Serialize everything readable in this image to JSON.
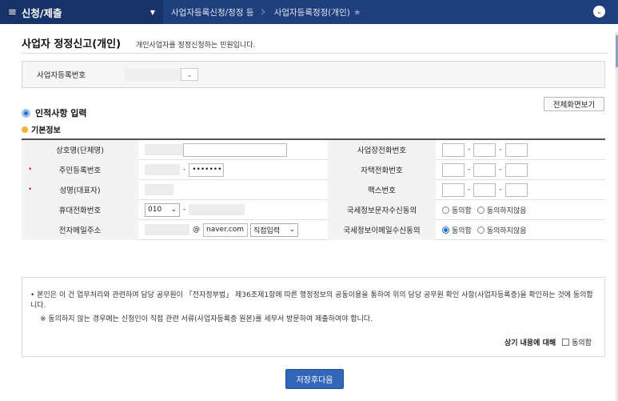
{
  "nav": {
    "menu_title": "신청/제출",
    "crumbs": [
      "사업자등록신청/정정 등",
      "사업자등록정정(개인)"
    ]
  },
  "page": {
    "title": "사업자 정정신고(개인)",
    "desc": "개인사업자를 정정신청하는 민원입니다."
  },
  "bizno": {
    "label": "사업자등록번호"
  },
  "sections": {
    "personal": "인적사항 입력",
    "basic": "기본정보",
    "fullview_btn": "전체화면보기"
  },
  "form": {
    "trade_name": "상호명(단체명)",
    "resident_no": "주민등록번호",
    "resident_masked": "•••••••",
    "name": "성명(대표자)",
    "mobile": "휴대전화번호",
    "mobile_prefix": "010",
    "email": "전자메일주소",
    "email_domain": "naver.com",
    "email_select": "직접입력",
    "biz_phone": "사업장전화번호",
    "home_phone": "자택전화번호",
    "fax": "팩스번호",
    "sms_consent": "국세정보문자수신동의",
    "email_consent": "국세정보이메일수신동의",
    "agree": "동의함",
    "disagree": "동의하지않음",
    "at": "@",
    "dash": "-"
  },
  "consent": {
    "text1": "• 본인은 이 건 업무처리와 관련하여 담당 공무원이 「전자정부법」 제36조제1항에 따른 행정정보의 공동이용을 통하여 위의 담당 공무원 확인 사항(사업자등록증)을 확인하는 것에 동의합니다.",
    "text2": "※  동의하지 않는 경우에는 신청인이 직접 관련 서류(사업자등록증 원본)를 세무서 방문하여 제출하여야 합니다.",
    "agree_label": "상기 내용에 대해",
    "agree_check": "동의함"
  },
  "buttons": {
    "save_next": "저장후다음"
  }
}
